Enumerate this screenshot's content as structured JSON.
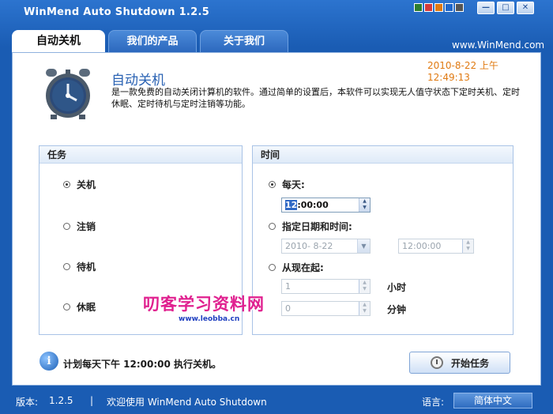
{
  "window": {
    "title": "WinMend Auto Shutdown 1.2.5"
  },
  "skin_colors": [
    "#2e7d2e",
    "#d43a3a",
    "#e07a12",
    "#1f66c9",
    "#555555"
  ],
  "controls": {
    "minimize": "▢",
    "restore": "□",
    "close": "✕"
  },
  "tabs": [
    "自动关机",
    "我们的产品",
    "关于我们"
  ],
  "site": "www.WinMend.com",
  "datetime": "2010-8-22 上午 12:49:13",
  "app": {
    "title": "自动关机",
    "description": "是一款免费的自动关闭计算机的软件。通过简单的设置后，本软件可以实现无人值守状态下定时关机、定时休眠、定时待机与定时注销等功能。"
  },
  "task_group": {
    "header": "任务",
    "options": [
      {
        "label": "关机",
        "selected": true
      },
      {
        "label": "注销",
        "selected": false
      },
      {
        "label": "待机",
        "selected": false
      },
      {
        "label": "休眠",
        "selected": false
      }
    ]
  },
  "time_group": {
    "header": "时间",
    "daily": {
      "label": "每天:",
      "selected": true,
      "time_hour": "12",
      "time_rest": ":00:00"
    },
    "specific": {
      "label": "指定日期和时间:",
      "selected": false,
      "date": "2010- 8-22",
      "time": "12:00:00"
    },
    "from_now": {
      "label": "从现在起:",
      "selected": false,
      "hours": "1",
      "hours_unit": "小时",
      "minutes": "0",
      "minutes_unit": "分钟"
    }
  },
  "watermark": {
    "text": "叨客学习资料网",
    "url": "www.leobba.cn"
  },
  "info": {
    "icon": "i",
    "text": "计划每天下午 12:00:00 执行关机。"
  },
  "start_button": {
    "label": "开始任务"
  },
  "status": {
    "version_label": "版本:",
    "version": "1.2.5",
    "separator": "|",
    "welcome": "欢迎使用 WinMend Auto Shutdown",
    "language_label": "语言:",
    "language": "简体中文"
  }
}
